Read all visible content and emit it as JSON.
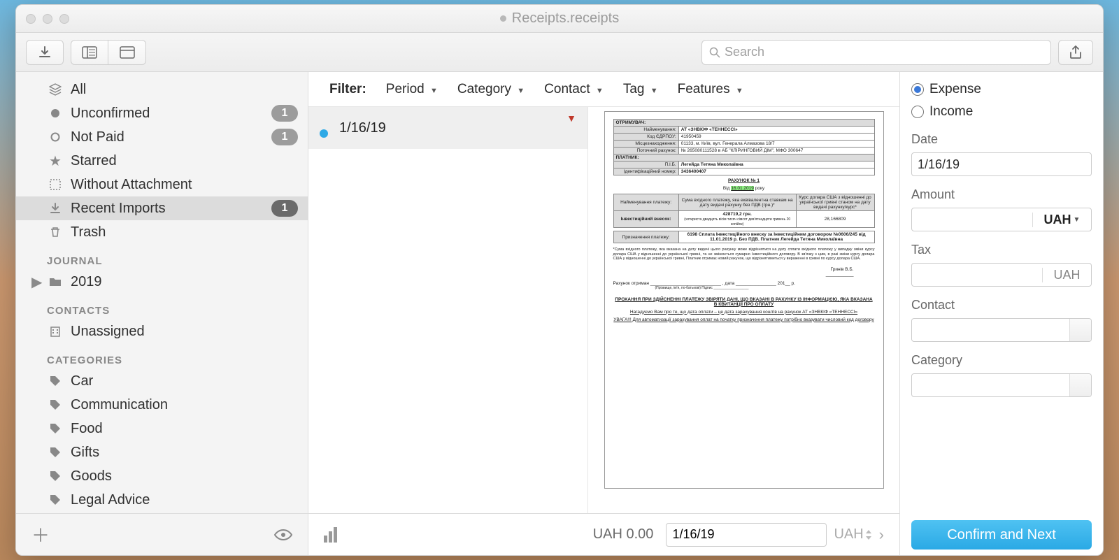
{
  "window": {
    "title": "Receipts.receipts"
  },
  "toolbar": {
    "search_placeholder": "Search"
  },
  "sidebar": {
    "smart": {
      "all": "All",
      "unconfirmed": "Unconfirmed",
      "not_paid": "Not Paid",
      "starred": "Starred",
      "without_attachment": "Without Attachment",
      "recent_imports": "Recent Imports",
      "trash": "Trash",
      "badge_unconfirmed": "1",
      "badge_not_paid": "1",
      "badge_recent": "1"
    },
    "journal_header": "JOURNAL",
    "journal_year": "2019",
    "contacts_header": "CONTACTS",
    "unassigned": "Unassigned",
    "categories_header": "CATEGORIES",
    "categories": {
      "c0": "Car",
      "c1": "Communication",
      "c2": "Food",
      "c3": "Gifts",
      "c4": "Goods",
      "c5": "Legal Advice"
    }
  },
  "filter": {
    "label": "Filter:",
    "period": "Period",
    "category": "Category",
    "contact": "Contact",
    "tag": "Tag",
    "features": "Features"
  },
  "list": {
    "row0_date": "1/16/19"
  },
  "doc": {
    "recipient_hdr": "ОТРИМУВАЧ:",
    "name_lbl": "Найменування:",
    "name_val": "АТ «ЗНВКІФ «ТЕННЕССІ»",
    "edrpou_lbl": "Код ЄДРПОУ:",
    "edrpou_val": "41950459",
    "addr_lbl": "Місцезнаходження:",
    "addr_val": "01133, м. Київ, вул. Генерала Алмазова 18/7",
    "acct_lbl": "Поточний рахунок:",
    "acct_val": "№ 265080111528 в АБ \"КЛІРИНГОВИЙ ДІМ\", МФО 300647",
    "payer_hdr": "ПЛАТНИК:",
    "pib_lbl": "П.І.Б.",
    "pib_val": "Легейда Тетяна Миколаївна",
    "inn_lbl": "Ідентифікаційний номер:",
    "inn_val": "3436400407",
    "invoice_title": "РАХУНОК № 1",
    "date_prefix": "Від",
    "date_hl": "16.01.2019",
    "date_suffix": "року",
    "col1": "Найменування платежу:",
    "col2": "Сума вхідного платежу, яка еквівалентна ставкам на дату видачі рахунку без ПДВ (грн.)*",
    "col3": "Курс долара США з відношенні до української гривні станом на дату видачі рахунку/курс*",
    "r_name": "Інвестиційний внесок:",
    "r_amount": "428719,2 грн.",
    "r_amount_sub": "(чотириста двадцять вісім тисяч сімсот дев'ятнадцяти гривень 20 копійок)",
    "r_rate": "28,166809",
    "purpose_lbl": "Призначення платежу:",
    "purpose_val": "6198 Сплата Інвестиційного внеску за Інвестиційним договором №0606/245 від 11.01.2019 р. Без ПДВ. Платник Легейда Тетяна Миколаївна",
    "note": "*Сума вхідного платежу, яка вказана на дату видачі цього рахунку може відрізнятися на дату сплати вхідного платежу у випадку зміни курсу долара США у відношенні до української гривні, та не змінюється сумарно Інвестиційного договору. В зв'язку з цим, в разі зміни курсу долара США у відношенні до української гривні, Платник отримає новий рахунок, що відрізнятиметься у вираженні в гривні по курсу долара США.",
    "sign": "Гринів В.Б.",
    "rcvd": "Рахунок отриман ____________________________ , дата ________________ 201__ р.",
    "rcvd_sub": "(Прізвище, ім'я, по-батькові)                                   Підпис __________________",
    "warn1": "ПРОХАННЯ ПРИ ЗДІЙСНЕННІ ПЛАТЕЖУ ЗВІРЯТИ ДАНІ, ЩО ВКАЗАНІ В РАХУНКУ ІЗ ІНФОРМАЦІЄЮ, ЯКА ВКАЗАНА В КВИТАНЦІЇ ПРО ОПЛАТУ",
    "warn2": "Нагадуємо Вам про те, що дата оплати – це дата зарахування коштів на рахунок АТ «ЗНВКІФ «ТЕННЕССІ»",
    "warn3": "УВАГА!!! Для автоматизації зарахування оплат на початку призначення платежу потрібно вказувати числовий код договору"
  },
  "footer": {
    "total": "UAH 0.00",
    "date": "1/16/19",
    "currency": "UAH"
  },
  "details": {
    "expense": "Expense",
    "income": "Income",
    "date_label": "Date",
    "date_value": "1/16/19",
    "amount_label": "Amount",
    "amount_currency": "UAH",
    "tax_label": "Tax",
    "tax_currency": "UAH",
    "contact_label": "Contact",
    "category_label": "Category",
    "confirm": "Confirm and Next"
  }
}
